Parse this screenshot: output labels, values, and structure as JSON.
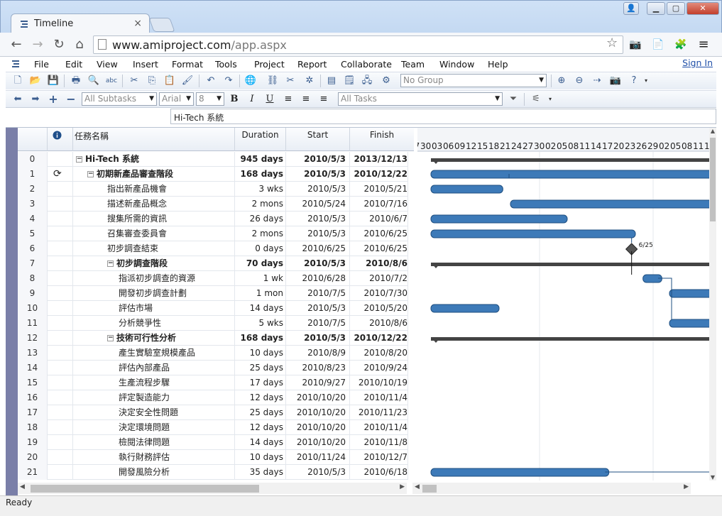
{
  "browser": {
    "tab_title": "Timeline",
    "url_host": "www.amiproject.com",
    "url_path": "/app.aspx"
  },
  "menu": [
    "File",
    "Edit",
    "View",
    "Insert",
    "Format",
    "Tools",
    "Project",
    "Report",
    "Collaborate",
    "Team",
    "Window",
    "Help"
  ],
  "sign_in": "Sign In",
  "toolbar": {
    "group_select": "No Group",
    "subtasks_select": "All Subtasks",
    "font_select": "Arial",
    "size_select": "8",
    "tasks_filter": "All Tasks",
    "bold": "B",
    "italic": "I",
    "underline": "U"
  },
  "formula_value": "Hi-Tech 系統",
  "columns": {
    "name": "任務名稱",
    "duration": "Duration",
    "start": "Start",
    "finish": "Finish"
  },
  "timescale": [
    "27",
    "30",
    "03",
    "06",
    "09",
    "12",
    "15",
    "18",
    "21",
    "24",
    "27",
    "30",
    "02",
    "05",
    "08",
    "11",
    "14",
    "17",
    "20",
    "23",
    "26",
    "29",
    "02",
    "05",
    "08",
    "11",
    "1"
  ],
  "rows": [
    {
      "id": "0",
      "name": "Hi-Tech 系統",
      "duration": "945 days",
      "start": "2010/5/3",
      "finish": "2013/12/13",
      "level": 0,
      "summary": true
    },
    {
      "id": "1",
      "name": "初期新產品審查階段",
      "duration": "168 days",
      "start": "2010/5/3",
      "finish": "2010/12/22",
      "level": 1,
      "summary": true,
      "recur": true
    },
    {
      "id": "2",
      "name": "指出新產品機會",
      "duration": "3 wks",
      "start": "2010/5/3",
      "finish": "2010/5/21",
      "level": 2
    },
    {
      "id": "3",
      "name": "描述新產品概念",
      "duration": "2 mons",
      "start": "2010/5/24",
      "finish": "2010/7/16",
      "level": 2
    },
    {
      "id": "4",
      "name": "搜集所需的資訊",
      "duration": "26 days",
      "start": "2010/5/3",
      "finish": "2010/6/7",
      "level": 2
    },
    {
      "id": "5",
      "name": "召集審查委員會",
      "duration": "2 mons",
      "start": "2010/5/3",
      "finish": "2010/6/25",
      "level": 2
    },
    {
      "id": "6",
      "name": "初步調查結束",
      "duration": "0 days",
      "start": "2010/6/25",
      "finish": "2010/6/25",
      "level": 2
    },
    {
      "id": "7",
      "name": "初步調查階段",
      "duration": "70 days",
      "start": "2010/5/3",
      "finish": "2010/8/6",
      "level": 2,
      "summary": true
    },
    {
      "id": "8",
      "name": "指派初步調查的資源",
      "duration": "1 wk",
      "start": "2010/6/28",
      "finish": "2010/7/2",
      "level": 3
    },
    {
      "id": "9",
      "name": "開發初步調查計劃",
      "duration": "1 mon",
      "start": "2010/7/5",
      "finish": "2010/7/30",
      "level": 3
    },
    {
      "id": "10",
      "name": "評估市場",
      "duration": "14 days",
      "start": "2010/5/3",
      "finish": "2010/5/20",
      "level": 3
    },
    {
      "id": "11",
      "name": "分析競爭性",
      "duration": "5 wks",
      "start": "2010/7/5",
      "finish": "2010/8/6",
      "level": 3
    },
    {
      "id": "12",
      "name": "技術可行性分析",
      "duration": "168 days",
      "start": "2010/5/3",
      "finish": "2010/12/22",
      "level": 2,
      "summary": true
    },
    {
      "id": "13",
      "name": "產生實驗室規模產品",
      "duration": "10 days",
      "start": "2010/8/9",
      "finish": "2010/8/20",
      "level": 3
    },
    {
      "id": "14",
      "name": "評估內部產品",
      "duration": "25 days",
      "start": "2010/8/23",
      "finish": "2010/9/24",
      "level": 3
    },
    {
      "id": "15",
      "name": "生產流程步驟",
      "duration": "17 days",
      "start": "2010/9/27",
      "finish": "2010/10/19",
      "level": 3
    },
    {
      "id": "16",
      "name": "評定製造能力",
      "duration": "12 days",
      "start": "2010/10/20",
      "finish": "2010/11/4",
      "level": 3
    },
    {
      "id": "17",
      "name": "決定安全性問題",
      "duration": "25 days",
      "start": "2010/10/20",
      "finish": "2010/11/23",
      "level": 3
    },
    {
      "id": "18",
      "name": "決定環境問題",
      "duration": "12 days",
      "start": "2010/10/20",
      "finish": "2010/11/4",
      "level": 3
    },
    {
      "id": "19",
      "name": "檢閱法律問題",
      "duration": "14 days",
      "start": "2010/10/20",
      "finish": "2010/11/8",
      "level": 3
    },
    {
      "id": "20",
      "name": "執行財務評估",
      "duration": "10 days",
      "start": "2010/11/24",
      "finish": "2010/12/7",
      "level": 3
    },
    {
      "id": "21",
      "name": "開發風險分析",
      "duration": "35 days",
      "start": "2010/5/3",
      "finish": "2010/6/18",
      "level": 3
    }
  ],
  "milestone_label": "6/25",
  "status": "Ready"
}
